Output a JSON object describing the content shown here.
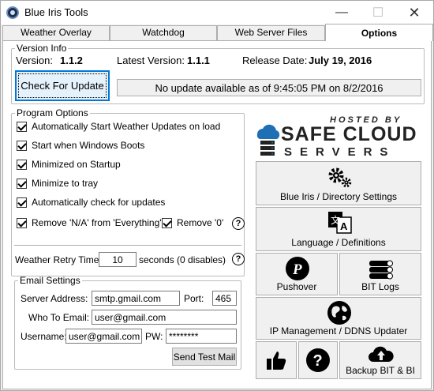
{
  "window": {
    "title": "Blue Iris Tools",
    "min": "—",
    "max": "☐",
    "close": "✕"
  },
  "tabs": [
    {
      "label": "Weather Overlay"
    },
    {
      "label": "Watchdog"
    },
    {
      "label": "Web Server Files"
    },
    {
      "label": "Options"
    }
  ],
  "version_info": {
    "legend": "Version Info",
    "version_label": "Version:",
    "version_value": "1.1.2",
    "latest_label": "Latest Version:",
    "latest_value": "1.1.1",
    "release_label": "Release Date:",
    "release_value": "July 19, 2016",
    "check_button": "Check For Update",
    "status": "No update available as of 9:45:05 PM on 8/2/2016"
  },
  "program_options": {
    "legend": "Program Options",
    "checks": [
      {
        "label": "Automatically Start Weather Updates on load",
        "checked": true
      },
      {
        "label": "Start when Windows Boots",
        "checked": true
      },
      {
        "label": "Minimized on Startup",
        "checked": true
      },
      {
        "label": "Minimize to tray",
        "checked": true
      },
      {
        "label": "Automatically check for updates",
        "checked": true
      }
    ],
    "remove_na": "Remove 'N/A' from 'Everything'",
    "remove_zero": "Remove '0'",
    "help": "?",
    "retry_label": "Weather Retry Time",
    "retry_value": "10",
    "retry_suffix": "seconds (0 disables)"
  },
  "email": {
    "legend": "Email Settings",
    "server_label": "Server Address:",
    "server_value": "smtp.gmail.com",
    "port_label": "Port:",
    "port_value": "465",
    "to_label": "Who To Email:",
    "to_value": "user@gmail.com",
    "user_label": "Username:",
    "user_value": "user@gmail.com",
    "pw_label": "PW:",
    "pw_value": "********",
    "test_button": "Send Test Mail"
  },
  "logo": {
    "line1": "HOSTED BY",
    "line2": "SAFE CLOUD",
    "line3": "SERVERS"
  },
  "tiles": {
    "bi_settings": "Blue Iris / Directory Settings",
    "language": "Language / Definitions",
    "pushover": "Pushover",
    "bit_logs": "BIT Logs",
    "ip_mgmt": "IP Management / DDNS Updater",
    "backup": "Backup BIT & BI"
  },
  "colors": {
    "accent": "#0078d7",
    "logo_blue": "#1f6fb5",
    "logo_dark": "#222222"
  }
}
